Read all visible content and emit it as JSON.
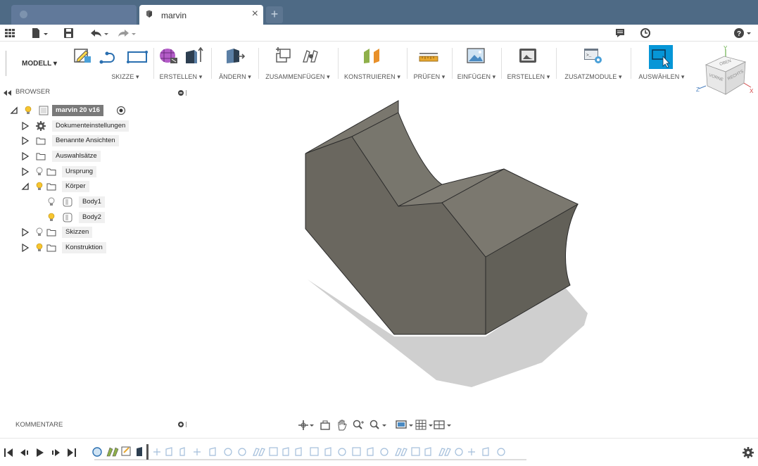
{
  "tabs": {
    "active_title": "marvin",
    "close_glyph": "×",
    "add_glyph": "+"
  },
  "toolbar": {
    "workspace_label": "MODELL ▾",
    "groups": [
      {
        "label": "SKIZZE ▾"
      },
      {
        "label": "ERSTELLEN ▾"
      },
      {
        "label": "ÄNDERN ▾"
      },
      {
        "label": "ZUSAMMENFÜGEN ▾"
      },
      {
        "label": "KONSTRUIEREN ▾"
      },
      {
        "label": "PRÜFEN ▾"
      },
      {
        "label": "EINFÜGEN ▾"
      },
      {
        "label": "ERSTELLEN ▾"
      },
      {
        "label": "ZUSATZMODULE ▾"
      },
      {
        "label": "AUSWÄHLEN ▾"
      }
    ]
  },
  "viewcube": {
    "top": "OBEN",
    "front": "VORNE",
    "right": "RECHTS",
    "axis_x": "X",
    "axis_y": "Y",
    "axis_z": "Z"
  },
  "browser": {
    "title": "BROWSER",
    "root": "marvin 20 v16",
    "items": [
      {
        "label": "Dokumenteinstellungen"
      },
      {
        "label": "Benannte Ansichten"
      },
      {
        "label": "Auswahlsätze"
      },
      {
        "label": "Ursprung"
      },
      {
        "label": "Körper"
      },
      {
        "label": "Body1"
      },
      {
        "label": "Body2"
      },
      {
        "label": "Skizzen"
      },
      {
        "label": "Konstruktion"
      }
    ]
  },
  "comments": {
    "title": "KOMMENTARE"
  },
  "colors": {
    "tabbar": "#4e6a85",
    "accent": "#0696d7",
    "body": "#6f6c63"
  }
}
